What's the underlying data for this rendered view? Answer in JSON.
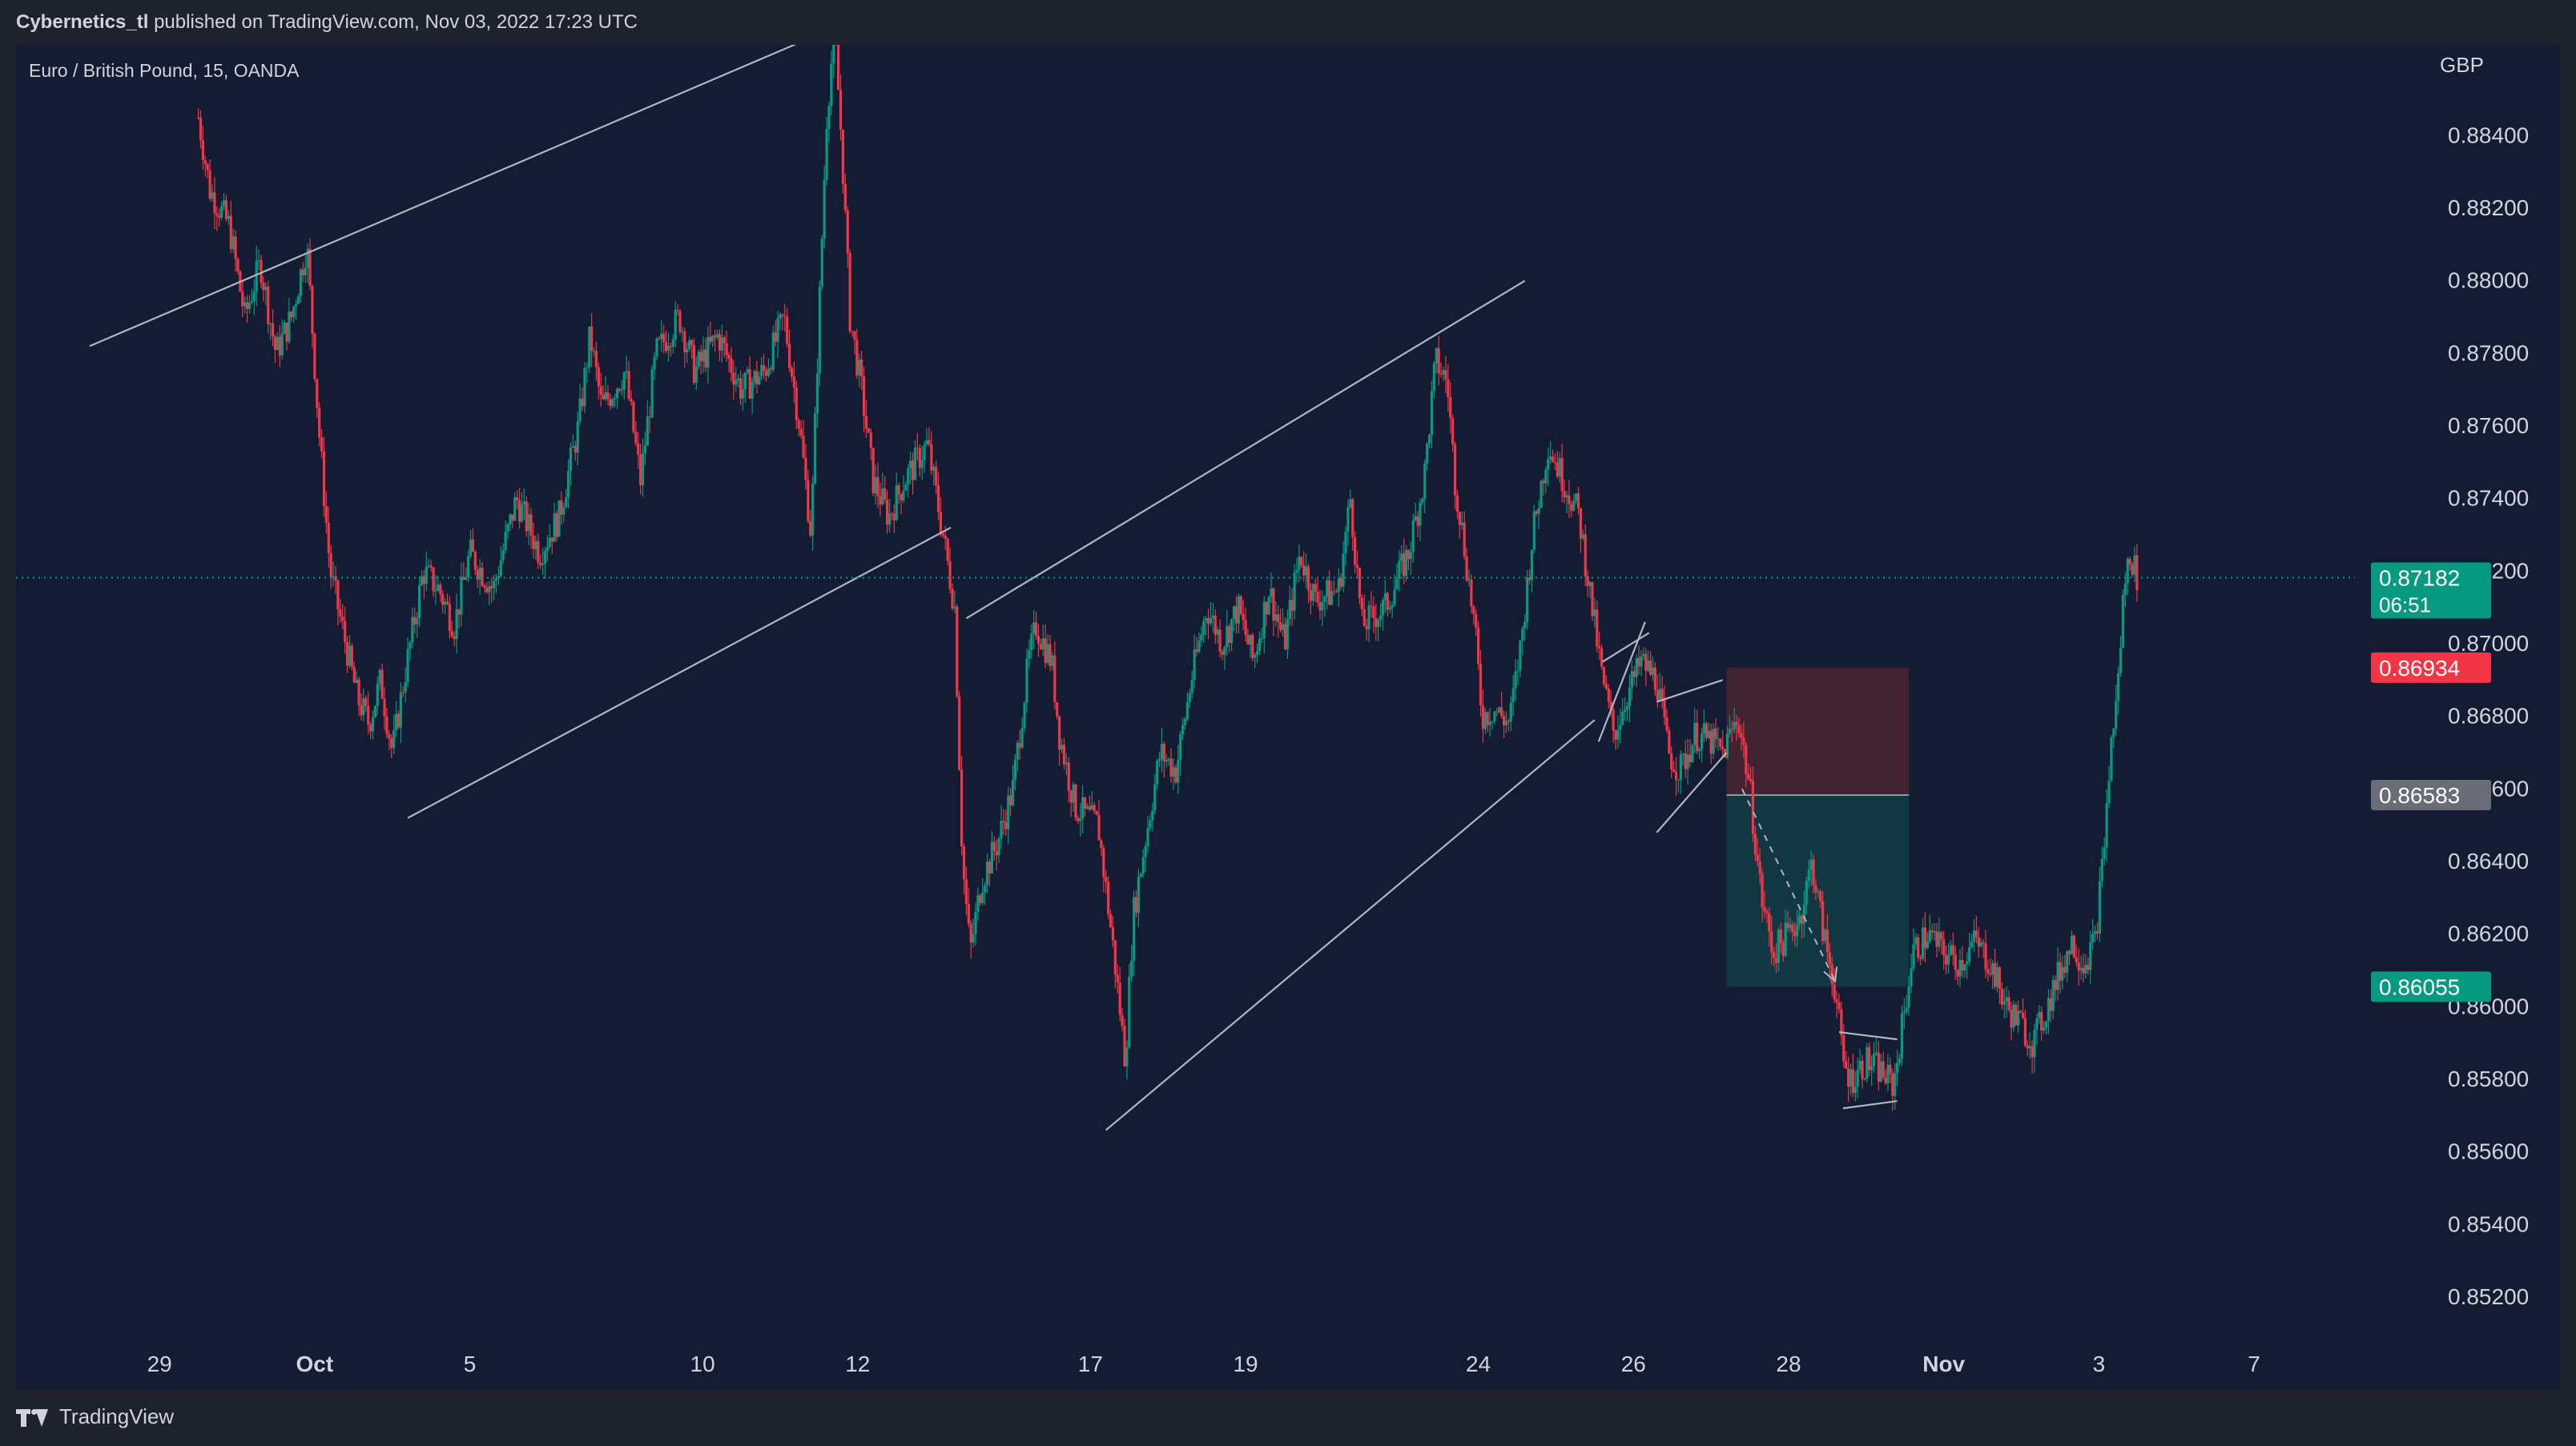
{
  "header": {
    "author": "Cybernetics_tl",
    "published_text": " published on TradingView.com, Nov 03, 2022 17:23 UTC"
  },
  "footer": {
    "brand": "TradingView"
  },
  "colors": {
    "background": "#131c33",
    "frame": "#1e222d",
    "text": "#d1d4dc",
    "candle_up": "#089981",
    "candle_down": "#f23645",
    "trend_line": "#b2b5be",
    "price_badge_current": "#089981",
    "price_badge_stop": "#f23645",
    "price_badge_entry": "#6a6d78",
    "price_badge_target": "#089981",
    "short_risk_zone": "#4a2433",
    "short_reward_zone": "#123b44"
  },
  "icons": {
    "brand_logo": "tradingview-logo-icon"
  },
  "chart_data": {
    "type": "candlestick",
    "symbol_label": "Euro / British Pound, 15, OANDA",
    "currency_label": "GBP",
    "ylim": [
      0.8505,
      0.8865
    ],
    "y_ticks": [
      "0.88400",
      "0.88200",
      "0.88000",
      "0.87800",
      "0.87600",
      "0.87400",
      "0.87200",
      "0.87000",
      "0.86800",
      "0.86600",
      "0.86400",
      "0.86200",
      "0.86000",
      "0.85800",
      "0.85600",
      "0.85400",
      "0.85200"
    ],
    "x_ticks": [
      {
        "label": "29",
        "bold": false,
        "x": -1.6
      },
      {
        "label": "Oct",
        "bold": true,
        "x": 0.4
      },
      {
        "label": "5",
        "bold": false,
        "x": 2.4
      },
      {
        "label": "10",
        "bold": false,
        "x": 5.4
      },
      {
        "label": "12",
        "bold": false,
        "x": 7.4
      },
      {
        "label": "17",
        "bold": false,
        "x": 10.4
      },
      {
        "label": "19",
        "bold": false,
        "x": 12.4
      },
      {
        "label": "24",
        "bold": false,
        "x": 15.4
      },
      {
        "label": "26",
        "bold": false,
        "x": 17.4
      },
      {
        "label": "28",
        "bold": false,
        "x": 19.4
      },
      {
        "label": "Nov",
        "bold": true,
        "x": 21.4
      },
      {
        "label": "3",
        "bold": false,
        "x": 23.4
      },
      {
        "label": "7",
        "bold": false,
        "x": 25.4
      }
    ],
    "xlim": [
      -3.45,
      26.7
    ],
    "path": [
      [
        -1.1,
        0.8845
      ],
      [
        -0.95,
        0.8825
      ],
      [
        -0.7,
        0.8815
      ],
      [
        -0.5,
        0.879
      ],
      [
        -0.3,
        0.8805
      ],
      [
        -0.1,
        0.878
      ],
      [
        0.1,
        0.879
      ],
      [
        0.3,
        0.881
      ],
      [
        0.45,
        0.876
      ],
      [
        0.6,
        0.872
      ],
      [
        0.8,
        0.87
      ],
      [
        0.95,
        0.8685
      ],
      [
        1.1,
        0.8678
      ],
      [
        1.25,
        0.869
      ],
      [
        1.4,
        0.867
      ],
      [
        1.55,
        0.869
      ],
      [
        1.8,
        0.872
      ],
      [
        2.0,
        0.8715
      ],
      [
        2.2,
        0.8705
      ],
      [
        2.4,
        0.8725
      ],
      [
        2.7,
        0.8715
      ],
      [
        3.0,
        0.874
      ],
      [
        3.3,
        0.8725
      ],
      [
        3.55,
        0.8735
      ],
      [
        3.8,
        0.876
      ],
      [
        3.95,
        0.8785
      ],
      [
        4.1,
        0.8765
      ],
      [
        4.4,
        0.8775
      ],
      [
        4.6,
        0.8745
      ],
      [
        4.8,
        0.878
      ],
      [
        5.1,
        0.879
      ],
      [
        5.3,
        0.8775
      ],
      [
        5.6,
        0.8785
      ],
      [
        5.9,
        0.877
      ],
      [
        6.2,
        0.8775
      ],
      [
        6.45,
        0.879
      ],
      [
        6.65,
        0.876
      ],
      [
        6.8,
        0.873
      ],
      [
        6.9,
        0.879
      ],
      [
        7.0,
        0.8845
      ],
      [
        7.1,
        0.887
      ],
      [
        7.2,
        0.8835
      ],
      [
        7.3,
        0.879
      ],
      [
        7.45,
        0.877
      ],
      [
        7.6,
        0.8745
      ],
      [
        7.8,
        0.8735
      ],
      [
        8.0,
        0.8745
      ],
      [
        8.3,
        0.8755
      ],
      [
        8.5,
        0.873
      ],
      [
        8.65,
        0.871
      ],
      [
        8.75,
        0.864
      ],
      [
        8.85,
        0.8615
      ],
      [
        9.0,
        0.8635
      ],
      [
        9.2,
        0.8645
      ],
      [
        9.4,
        0.866
      ],
      [
        9.6,
        0.8695
      ],
      [
        9.7,
        0.8705
      ],
      [
        9.9,
        0.8695
      ],
      [
        10.0,
        0.8675
      ],
      [
        10.2,
        0.8655
      ],
      [
        10.5,
        0.865
      ],
      [
        10.7,
        0.8615
      ],
      [
        10.85,
        0.8585
      ],
      [
        10.95,
        0.8625
      ],
      [
        11.1,
        0.8645
      ],
      [
        11.3,
        0.867
      ],
      [
        11.5,
        0.8665
      ],
      [
        11.7,
        0.869
      ],
      [
        11.9,
        0.871
      ],
      [
        12.1,
        0.87
      ],
      [
        12.3,
        0.871
      ],
      [
        12.5,
        0.8695
      ],
      [
        12.7,
        0.8715
      ],
      [
        12.9,
        0.87
      ],
      [
        13.1,
        0.8725
      ],
      [
        13.3,
        0.8712
      ],
      [
        13.6,
        0.8715
      ],
      [
        13.75,
        0.874
      ],
      [
        13.9,
        0.8705
      ],
      [
        14.2,
        0.871
      ],
      [
        14.5,
        0.8725
      ],
      [
        14.7,
        0.8745
      ],
      [
        14.85,
        0.8778
      ],
      [
        15.0,
        0.8772
      ],
      [
        15.1,
        0.8745
      ],
      [
        15.2,
        0.873
      ],
      [
        15.35,
        0.8705
      ],
      [
        15.45,
        0.868
      ],
      [
        15.6,
        0.8682
      ],
      [
        15.8,
        0.8678
      ],
      [
        15.95,
        0.87
      ],
      [
        16.1,
        0.873
      ],
      [
        16.3,
        0.8755
      ],
      [
        16.5,
        0.8745
      ],
      [
        16.7,
        0.8735
      ],
      [
        16.9,
        0.8705
      ],
      [
        17.0,
        0.869
      ],
      [
        17.15,
        0.8675
      ],
      [
        17.3,
        0.8685
      ],
      [
        17.5,
        0.8695
      ],
      [
        17.7,
        0.869
      ],
      [
        17.85,
        0.867
      ],
      [
        18.0,
        0.8665
      ],
      [
        18.2,
        0.8675
      ],
      [
        18.4,
        0.8673
      ],
      [
        18.55,
        0.867
      ],
      [
        18.75,
        0.868
      ],
      [
        18.9,
        0.866
      ],
      [
        19.05,
        0.863
      ],
      [
        19.2,
        0.8615
      ],
      [
        19.4,
        0.862
      ],
      [
        19.55,
        0.8625
      ],
      [
        19.7,
        0.864
      ],
      [
        19.85,
        0.862
      ],
      [
        20.0,
        0.8605
      ],
      [
        20.1,
        0.8585
      ],
      [
        20.2,
        0.858
      ],
      [
        20.4,
        0.8585
      ],
      [
        20.6,
        0.8582
      ],
      [
        20.75,
        0.8578
      ],
      [
        20.9,
        0.86
      ],
      [
        21.0,
        0.8615
      ],
      [
        21.2,
        0.862
      ],
      [
        21.4,
        0.8615
      ],
      [
        21.6,
        0.8612
      ],
      [
        21.8,
        0.8618
      ],
      [
        22.0,
        0.8612
      ],
      [
        22.2,
        0.86
      ],
      [
        22.4,
        0.8595
      ],
      [
        22.55,
        0.859
      ],
      [
        22.7,
        0.8598
      ],
      [
        22.9,
        0.861
      ],
      [
        23.05,
        0.8618
      ],
      [
        23.2,
        0.8612
      ],
      [
        23.35,
        0.8618
      ],
      [
        23.45,
        0.864
      ],
      [
        23.55,
        0.867
      ],
      [
        23.65,
        0.869
      ],
      [
        23.72,
        0.8715
      ],
      [
        23.8,
        0.8725
      ],
      [
        23.9,
        0.8718
      ]
    ],
    "drawings": {
      "trend_lines": [
        {
          "from": [
            -2.5,
            0.8782
          ],
          "to": [
            6.8,
            0.8867
          ]
        },
        {
          "from": [
            1.6,
            0.8652
          ],
          "to": [
            8.6,
            0.8732
          ]
        },
        {
          "from": [
            8.8,
            0.8707
          ],
          "to": [
            16.0,
            0.88
          ]
        },
        {
          "from": [
            10.6,
            0.8566
          ],
          "to": [
            16.9,
            0.8679
          ]
        },
        {
          "from": [
            16.95,
            0.8673
          ],
          "to": [
            17.55,
            0.8706
          ]
        },
        {
          "from": [
            17.0,
            0.8695
          ],
          "to": [
            17.6,
            0.8703
          ]
        },
        {
          "from": [
            17.7,
            0.8684
          ],
          "to": [
            18.55,
            0.869
          ]
        },
        {
          "from": [
            17.7,
            0.8648
          ],
          "to": [
            18.6,
            0.867
          ]
        },
        {
          "from": [
            20.05,
            0.8593
          ],
          "to": [
            20.8,
            0.8591
          ]
        },
        {
          "from": [
            20.1,
            0.8572
          ],
          "to": [
            20.8,
            0.8574
          ]
        }
      ],
      "short_position": {
        "x_start": 18.6,
        "x_end": 20.95,
        "stop": 0.86934,
        "entry": 0.86583,
        "target": 0.86055
      },
      "projection_arrow": {
        "from": [
          18.8,
          0.866
        ],
        "to": [
          20.0,
          0.8607
        ]
      }
    },
    "price_labels": {
      "current_price": "0.87182",
      "countdown": "06:51",
      "stop": "0.86934",
      "entry": "0.86583",
      "target": "0.86055"
    },
    "current_value": 0.87182
  }
}
